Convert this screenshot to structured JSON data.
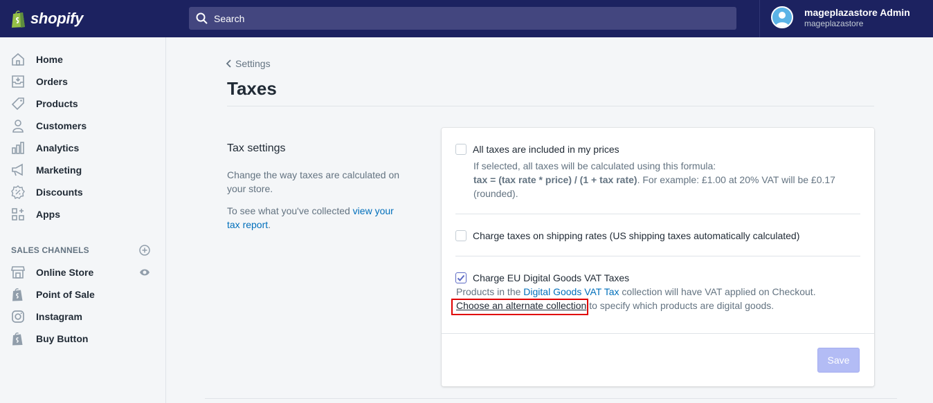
{
  "topbar": {
    "brand": "shopify",
    "search_placeholder": "Search",
    "user_name": "mageplazastore Admin",
    "store_name": "mageplazastore"
  },
  "sidebar": {
    "items": [
      {
        "label": "Home",
        "icon": "home-icon"
      },
      {
        "label": "Orders",
        "icon": "orders-icon"
      },
      {
        "label": "Products",
        "icon": "tag-icon"
      },
      {
        "label": "Customers",
        "icon": "person-icon"
      },
      {
        "label": "Analytics",
        "icon": "bar-chart-icon"
      },
      {
        "label": "Marketing",
        "icon": "megaphone-icon"
      },
      {
        "label": "Discounts",
        "icon": "discount-icon"
      },
      {
        "label": "Apps",
        "icon": "apps-icon"
      }
    ],
    "channels_heading": "SALES CHANNELS",
    "channels": [
      {
        "label": "Online Store",
        "icon": "store-icon"
      },
      {
        "label": "Point of Sale",
        "icon": "shopify-bag-icon"
      },
      {
        "label": "Instagram",
        "icon": "instagram-icon"
      },
      {
        "label": "Buy Button",
        "icon": "shopify-bag-icon"
      }
    ]
  },
  "page": {
    "breadcrumb": "Settings",
    "title": "Taxes"
  },
  "tax_settings": {
    "title": "Tax settings",
    "description": "Change the way taxes are calculated on your store.",
    "report_prefix": "To see what you've collected ",
    "report_link": "view your tax report",
    "report_suffix": "."
  },
  "card": {
    "option1": {
      "label": "All taxes are included in my prices",
      "checked": false,
      "help_line1": "If selected, all taxes will be calculated using this formula:",
      "formula": "tax = (tax rate * price) / (1 + tax rate)",
      "example": ". For example: £1.00 at 20% VAT will be £0.17",
      "example2": "(rounded)."
    },
    "option2": {
      "label": "Charge taxes on shipping rates (US shipping taxes automatically calculated)",
      "checked": false
    },
    "option3": {
      "label": "Charge EU Digital Goods VAT Taxes",
      "checked": true,
      "help_prefix": "Products in the ",
      "collection_link": "Digital Goods VAT Tax",
      "help_suffix": " collection will have VAT applied on Checkout.",
      "alt_link": "Choose an alternate collection",
      "alt_suffix": " to specify which products are digital goods."
    },
    "save_label": "Save"
  },
  "colors": {
    "topbar": "#1c2260",
    "search_bg": "#43467f",
    "link": "#006fbb",
    "save_disabled": "#b3bcf5",
    "highlight": "#e00000"
  }
}
